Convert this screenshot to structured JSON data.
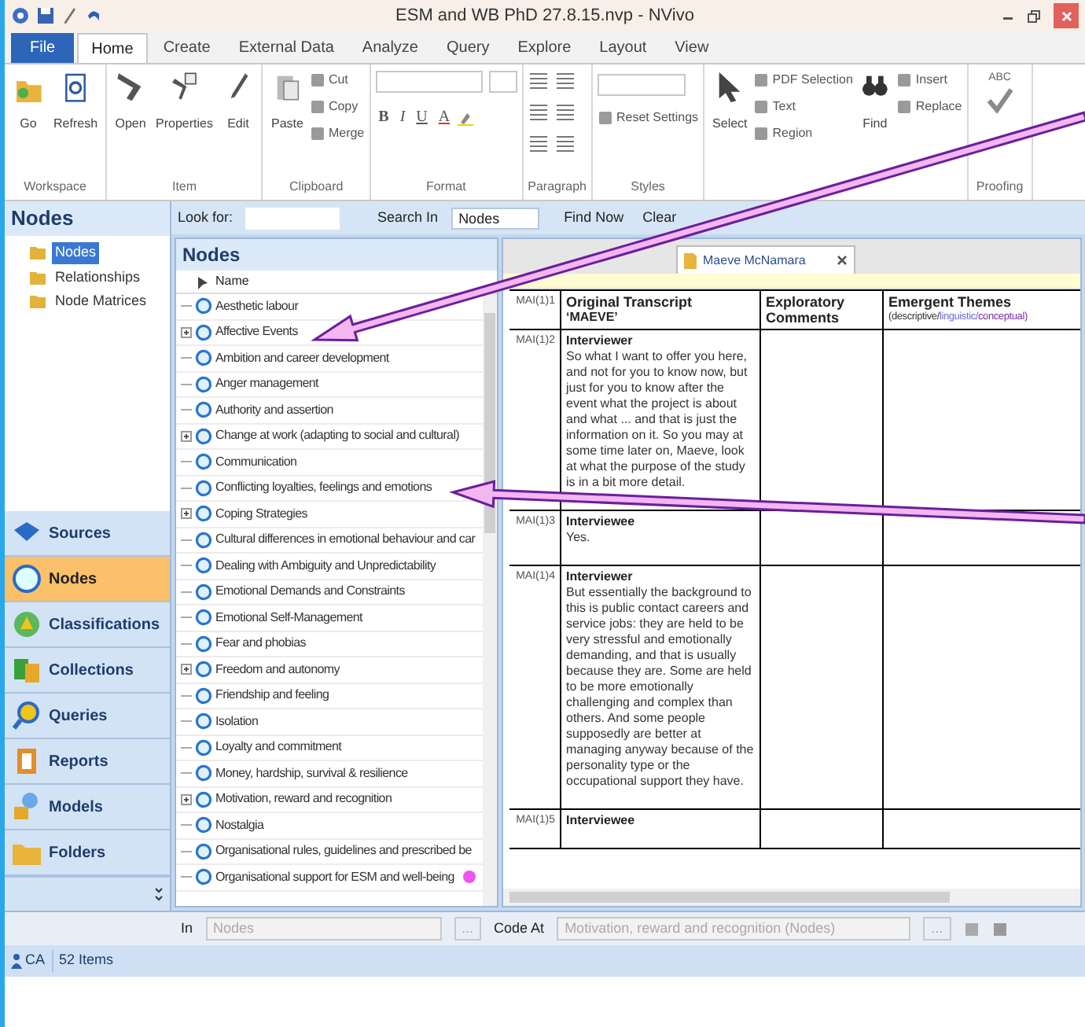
{
  "window": {
    "title": "ESM and WB PhD 27.8.15.nvp - NVivo"
  },
  "ribbon": {
    "tabs": [
      {
        "label": "File",
        "selected": false,
        "kind": "file"
      },
      {
        "label": "Home",
        "selected": true,
        "kind": "tab"
      },
      {
        "label": "Create",
        "selected": false,
        "kind": "tab"
      },
      {
        "label": "External Data",
        "selected": false,
        "kind": "tab"
      },
      {
        "label": "Analyze",
        "selected": false,
        "kind": "tab"
      },
      {
        "label": "Query",
        "selected": false,
        "kind": "tab"
      },
      {
        "label": "Explore",
        "selected": false,
        "kind": "tab"
      },
      {
        "label": "Layout",
        "selected": false,
        "kind": "tab"
      },
      {
        "label": "View",
        "selected": false,
        "kind": "tab"
      }
    ],
    "groups": [
      {
        "label": "Workspace",
        "items": [
          {
            "kind": "large",
            "label": "Go"
          },
          {
            "kind": "large",
            "label": "Refresh"
          }
        ]
      },
      {
        "label": "Item",
        "items": [
          {
            "kind": "large",
            "label": "Open"
          },
          {
            "kind": "large",
            "label": "Properties"
          },
          {
            "kind": "large",
            "label": "Edit"
          }
        ]
      },
      {
        "label": "Clipboard",
        "items": [
          {
            "kind": "large",
            "label": "Paste"
          },
          {
            "kind": "stack",
            "entries": [
              "Cut",
              "Copy",
              "Merge"
            ]
          }
        ]
      },
      {
        "label": "Format",
        "items": [
          {
            "kind": "format",
            "glyphs": [
              "B",
              "I",
              "U",
              "A"
            ]
          }
        ]
      },
      {
        "label": "Paragraph",
        "items": [
          {
            "kind": "paragraph"
          }
        ]
      },
      {
        "label": "Styles",
        "items": [
          {
            "kind": "styles",
            "label": "Reset Settings"
          }
        ]
      },
      {
        "items": [
          {
            "kind": "large",
            "label": "Select"
          },
          {
            "kind": "stack",
            "entries": [
              "PDF Selection",
              "Text",
              "Region"
            ]
          },
          {
            "kind": "large",
            "label": "Find"
          },
          {
            "kind": "stack",
            "entries": [
              "Insert",
              "Replace"
            ]
          }
        ]
      },
      {
        "label": "Proofing",
        "items": [
          {
            "kind": "spell",
            "label": "ABC"
          }
        ]
      }
    ]
  },
  "navigation": {
    "title": "Nodes",
    "tree": [
      {
        "label": "Nodes",
        "selected": true
      },
      {
        "label": "Relationships",
        "selected": false
      },
      {
        "label": "Node Matrices",
        "selected": false
      }
    ],
    "buttons": [
      {
        "label": "Sources",
        "selected": false
      },
      {
        "label": "Nodes",
        "selected": true
      },
      {
        "label": "Classifications",
        "selected": false
      },
      {
        "label": "Collections",
        "selected": false
      },
      {
        "label": "Queries",
        "selected": false
      },
      {
        "label": "Reports",
        "selected": false
      },
      {
        "label": "Models",
        "selected": false
      },
      {
        "label": "Folders",
        "selected": false
      }
    ]
  },
  "find_bar": {
    "look_for_label": "Look for:",
    "search_in_label": "Search In",
    "search_in_value": "Nodes",
    "find_now": "Find Now",
    "clear": "Clear"
  },
  "node_list": {
    "title": "Nodes",
    "column": "Name",
    "items": [
      {
        "name": "Aesthetic labour",
        "expandable": false,
        "marked": false
      },
      {
        "name": "Affective Events",
        "expandable": true,
        "marked": false
      },
      {
        "name": "Ambition and career development",
        "expandable": false,
        "marked": false
      },
      {
        "name": "Anger management",
        "expandable": false,
        "marked": false
      },
      {
        "name": "Authority and assertion",
        "expandable": false,
        "marked": false
      },
      {
        "name": "Change at work (adapting to social and cultural)",
        "expandable": true,
        "marked": false
      },
      {
        "name": "Communication",
        "expandable": false,
        "marked": false
      },
      {
        "name": "Conflicting loyalties, feelings and emotions",
        "expandable": false,
        "marked": false
      },
      {
        "name": "Coping Strategies",
        "expandable": true,
        "marked": false
      },
      {
        "name": "Cultural differences in emotional behaviour and car",
        "expandable": false,
        "marked": false
      },
      {
        "name": "Dealing with Ambiguity and Unpredictability",
        "expandable": false,
        "marked": false
      },
      {
        "name": "Emotional Demands and Constraints",
        "expandable": false,
        "marked": false
      },
      {
        "name": "Emotional Self-Management",
        "expandable": false,
        "marked": false
      },
      {
        "name": "Fear and phobias",
        "expandable": false,
        "marked": false
      },
      {
        "name": "Freedom and autonomy",
        "expandable": true,
        "marked": false
      },
      {
        "name": "Friendship and feeling",
        "expandable": false,
        "marked": false
      },
      {
        "name": "Isolation",
        "expandable": false,
        "marked": false
      },
      {
        "name": "Loyalty and commitment",
        "expandable": false,
        "marked": false
      },
      {
        "name": "Money, hardship, survival & resilience",
        "expandable": false,
        "marked": false
      },
      {
        "name": "Motivation, reward and recognition",
        "expandable": true,
        "marked": false
      },
      {
        "name": "Nostalgia",
        "expandable": false,
        "marked": false
      },
      {
        "name": "Organisational rules, guidelines and prescribed be",
        "expandable": false,
        "marked": false
      },
      {
        "name": "Organisational support for ESM and well-being",
        "expandable": false,
        "marked": true
      }
    ]
  },
  "document": {
    "tab": "Maeve McNamara",
    "header": {
      "ref": "MAI(1)1",
      "transcript": "Original Transcript",
      "transcript_sub": "‘MAEVE’",
      "comments": "Exploratory Comments",
      "themes": "Emergent Themes",
      "themes_sub": [
        {
          "text": "(descriptive/",
          "color": "#333333"
        },
        {
          "text": "linguistic/",
          "color": "#6b6bd6"
        },
        {
          "text": "conceptual)",
          "color": "#7a2aa8"
        }
      ]
    },
    "rows": [
      {
        "ref": "MAI(1)2",
        "speaker": "Interviewer",
        "text": "So what I want to offer you here, and not for you to know now, but just for you to know after the event what the project is about and what ... and that is just the information on it.  So you may at some time later on, Maeve, look at what the purpose of the study is in a bit more detail."
      },
      {
        "ref": "MAI(1)3",
        "speaker": "Interviewee",
        "text": "Yes."
      },
      {
        "ref": "MAI(1)4",
        "speaker": "Interviewer",
        "text": "But essentially the background to this is public contact careers and service jobs: they are held to be very stressful and emotionally demanding, and that is usually because they are.  Some are held to be more emotionally challenging and complex than others. And some people supposedly are better at managing anyway because of the personality type or the occupational support they have."
      },
      {
        "ref": "MAI(1)5",
        "speaker": "Interviewee"
      }
    ]
  },
  "coding_bar": {
    "in_label": "In",
    "in_value": "Nodes",
    "ellipsis": "...",
    "code_at_label": "Code At",
    "code_at_value": "Motivation, reward and recognition (Nodes)",
    "ellipsis_2": "..."
  },
  "status_bar": {
    "user": "CA",
    "count": "52 Items"
  },
  "annotations": [
    {
      "kind": "arrow"
    },
    {
      "kind": "arrow"
    }
  ]
}
